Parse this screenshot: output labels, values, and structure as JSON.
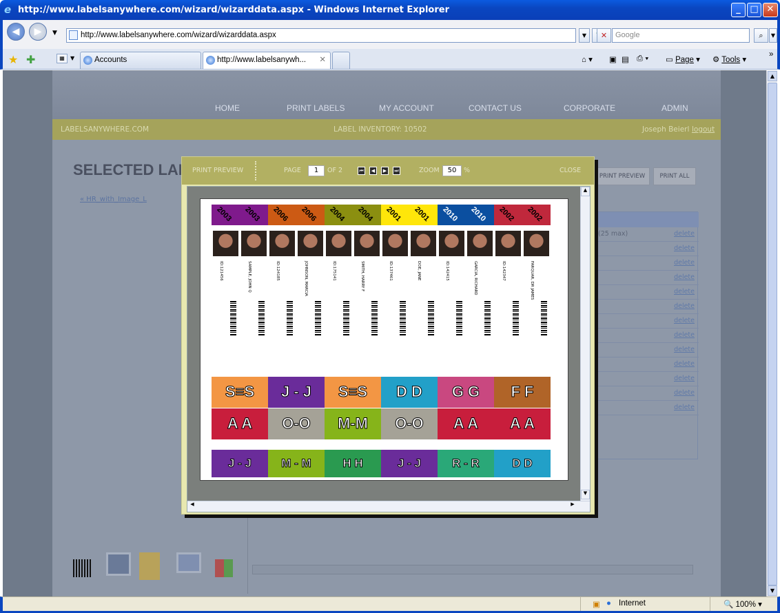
{
  "window": {
    "title": "http://www.labelsanywhere.com/wizard/wizarddata.aspx - Windows Internet Explorer"
  },
  "address": {
    "url": "http://www.labelsanywhere.com/wizard/wizarddata.aspx",
    "search_placeholder": "Google"
  },
  "tabs": [
    {
      "label": "Accounts"
    },
    {
      "label": "http://www.labelsanywh..."
    }
  ],
  "commands": {
    "page": "Page",
    "tools": "Tools"
  },
  "status": {
    "zone": "Internet",
    "zoom": "100%"
  },
  "site": {
    "nav": [
      "HOME",
      "PRINT LABELS",
      "MY ACCOUNT",
      "CONTACT US",
      "CORPORATE",
      "ADMIN"
    ],
    "domain": "LABELSANYWHERE.COM",
    "inventory": "LABEL INVENTORY: 10502",
    "user": "Joseph Beierl",
    "logout": "logout",
    "title": "SELECTED LABELS",
    "back_link": "« HR_with_Image_L",
    "print_preview": "PRINT PREVIEW",
    "print_all": "PRINT ALL",
    "grid_header": "(25 max)",
    "delete_label": "delete",
    "delete_count": 13
  },
  "modal": {
    "title": "PRINT PREVIEW",
    "page_label": "PAGE",
    "page_value": "1",
    "of_label": "OF 2",
    "zoom_label": "ZOOM",
    "zoom_value": "50",
    "zoom_unit": "%",
    "close": "CLOSE"
  },
  "labels": [
    {
      "year1": "2003",
      "year2": "2003",
      "color": "#7f1a8c",
      "t1": "ID:121456",
      "t2": "SAMPLE, JOHN Q"
    },
    {
      "year1": "2006",
      "year2": "2006",
      "color": "#cc5a14",
      "t1": "ID:124185",
      "t2": "JOHNSON, MARCIA"
    },
    {
      "year1": "2004",
      "year2": "2004",
      "color": "#8b8f10",
      "t1": "ID:175141",
      "t2": "SMITH, HARRY F"
    },
    {
      "year1": "2001",
      "year2": "2001",
      "color": "#ffe60a",
      "t1": "ID:137461",
      "t2": "DOE, JANE"
    },
    {
      "year1": "2010",
      "year2": "2010",
      "color": "#0b4fa0",
      "t1": "ID:142415",
      "t2": "GARCIA, RICHARD"
    },
    {
      "year1": "2002",
      "year2": "2002",
      "color": "#c0283c",
      "t1": "ID:142347",
      "t2": "FARQUAR, DR JAMES"
    }
  ],
  "letter_rows": [
    [
      {
        "text": "S≡S",
        "color": "#f39644"
      },
      {
        "text": "J - J",
        "color": "#6a2c9a"
      },
      {
        "text": "S≡S",
        "color": "#f39644"
      },
      {
        "text": "D   D",
        "color": "#22a0c8"
      },
      {
        "text": "G   G",
        "color": "#c94880"
      },
      {
        "text": "F   F",
        "color": "#b06428"
      }
    ],
    [
      {
        "text": "A   A",
        "color": "#c81e3c"
      },
      {
        "text": "O-O",
        "color": "#a5a297"
      },
      {
        "text": "M-M",
        "color": "#86b41a"
      },
      {
        "text": "O-O",
        "color": "#a5a297"
      },
      {
        "text": "A   A",
        "color": "#c81e3c"
      },
      {
        "text": "A   A",
        "color": "#c81e3c"
      }
    ],
    [
      {
        "text": "J - J",
        "color": "#6a2c9a"
      },
      {
        "text": "M - M",
        "color": "#86b41a"
      },
      {
        "text": "H   H",
        "color": "#2a9a50"
      },
      {
        "text": "J - J",
        "color": "#6a2c9a"
      },
      {
        "text": "R - R",
        "color": "#2aa878"
      },
      {
        "text": "D   D",
        "color": "#22a0c8"
      }
    ]
  ]
}
